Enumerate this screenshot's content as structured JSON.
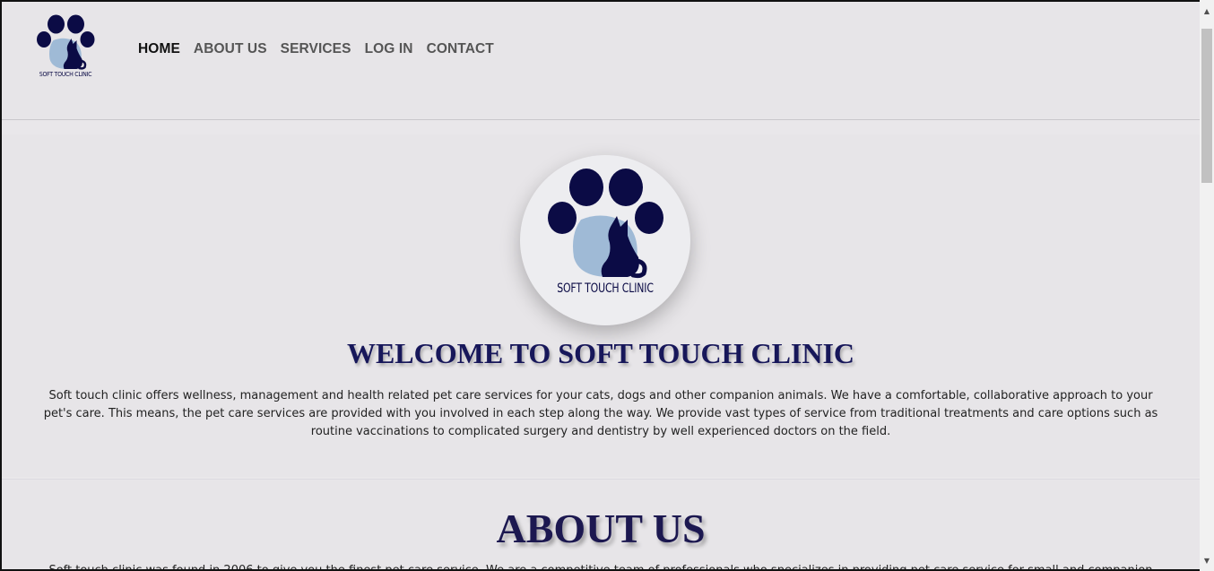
{
  "header": {
    "logo_text": "SOFT TOUCH CLINIC",
    "nav": [
      {
        "label": "HOME",
        "active": true
      },
      {
        "label": "ABOUT US",
        "active": false
      },
      {
        "label": "SERVICES",
        "active": false
      },
      {
        "label": "LOG IN",
        "active": false
      },
      {
        "label": "CONTACT",
        "active": false
      }
    ]
  },
  "welcome": {
    "logo_text": "SOFT TOUCH CLINIC",
    "title": "WELCOME TO SOFT TOUCH CLINIC",
    "text": "Soft touch clinic offers wellness, management and health related pet care services for your cats, dogs and other companion animals. We have a comfortable, collaborative approach to your pet's care. This means, the pet care services are provided with you involved in each step along the way. We provide vast types of service from traditional treatments and care options such as routine vaccinations to complicated surgery and dentistry by well experienced doctors on the field."
  },
  "about": {
    "title": "ABOUT US",
    "text": "Soft touch clinic was found in 2006 to give you the finest pet care service. We are a competitive team of professionals who specializes in providing pet care service for small and companion"
  },
  "icons": {
    "paw": "paw-cat-logo-icon",
    "scroll_up": "scroll-up-arrow-icon",
    "scroll_down": "scroll-down-arrow-icon"
  },
  "colors": {
    "brand_navy": "#0b0b45",
    "brand_light_blue": "#9fbad6",
    "page_background": "#e9e7ea"
  }
}
